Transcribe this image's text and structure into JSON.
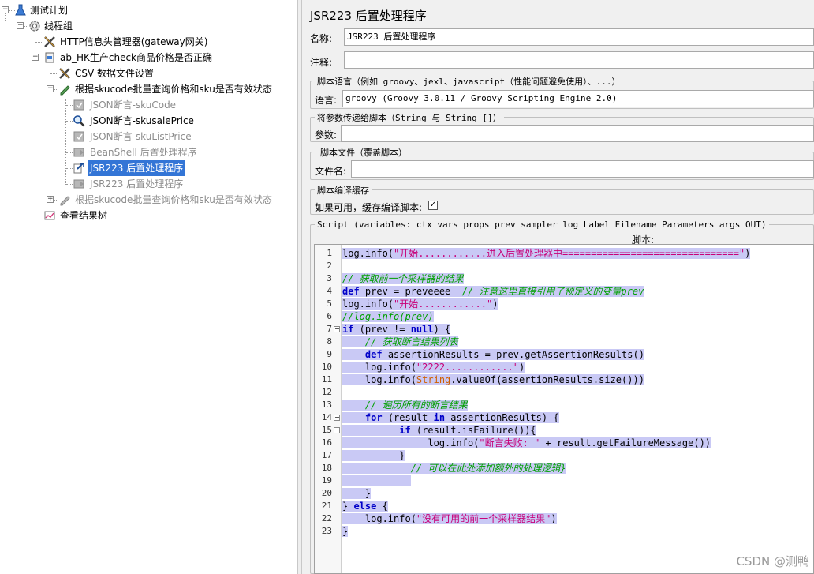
{
  "tree": {
    "nodes": [
      {
        "label": "测试计划",
        "icon": "test-plan-icon",
        "expander": "−"
      },
      {
        "label": "线程组",
        "icon": "thread-group-gear-icon",
        "expander": "−"
      },
      {
        "label": "HTTP信息头管理器(gateway网关)",
        "icon": "config-tools-icon"
      },
      {
        "label": "ab_HK生产check商品价格是否正确",
        "icon": "controller-icon",
        "expander": "−"
      },
      {
        "label": "CSV 数据文件设置",
        "icon": "config-tools-icon"
      },
      {
        "label": "根据skucode批量查询价格和sku是否有效状态",
        "icon": "sampler-pen-icon",
        "expander": "−"
      },
      {
        "label": "JSON断言-skuCode",
        "icon": "assertion-icon",
        "disabled": true
      },
      {
        "label": "JSON断言-skusalePrice",
        "icon": "magnifier-icon"
      },
      {
        "label": "JSON断言-skuListPrice",
        "icon": "assertion-icon",
        "disabled": true
      },
      {
        "label": "BeanShell 后置处理程序",
        "icon": "postprocessor-icon",
        "disabled": true
      },
      {
        "label": "JSR223 后置处理程序",
        "icon": "postprocessor-arrow-icon",
        "selected": true
      },
      {
        "label": "JSR223 后置处理程序",
        "icon": "postprocessor-icon",
        "disabled": true
      },
      {
        "label": "根据skucode批量查询价格和sku是否有效状态",
        "icon": "sampler-pen-icon",
        "expander": "+",
        "disabled": true
      },
      {
        "label": "查看结果树",
        "icon": "listener-chart-icon"
      }
    ]
  },
  "panel": {
    "title": "JSR223 后置处理程序",
    "name_label": "名称:",
    "name_value": "JSR223 后置处理程序",
    "comment_label": "注释:",
    "comment_value": "",
    "lang_group": "脚本语言（例如 groovy、jexl、javascript（性能问题避免使用）、...）",
    "lang_label": "语言:",
    "lang_value": "groovy     (Groovy 3.0.11 / Groovy Scripting Engine 2.0)",
    "params_group": "将参数传递给脚本（String 与 String []）",
    "params_label": "参数:",
    "params_value": "",
    "file_group": "脚本文件（覆盖脚本）",
    "file_label": "文件名:",
    "file_value": "",
    "cache_group": "脚本编译缓存",
    "cache_label": "如果可用，缓存编译脚本:",
    "cache_checked": "✓",
    "script_group": "Script (variables: ctx vars props prev sampler log Label Filename Parameters args OUT)",
    "script_label": "脚本:"
  },
  "code": {
    "line_numbers": [
      "1",
      "2",
      "3",
      "4",
      "5",
      "6",
      "7",
      "8",
      "9",
      "10",
      "11",
      "12",
      "13",
      "14",
      "15",
      "16",
      "17",
      "18",
      "19",
      "20",
      "21",
      "22",
      "23"
    ],
    "fold_markers": [
      {
        "line": 7,
        "glyph": "−"
      },
      {
        "line": 14,
        "glyph": "−"
      },
      {
        "line": 15,
        "glyph": "−"
      }
    ],
    "lines": [
      [
        {
          "t": "log.info("
        },
        {
          "t": "\"开始............进入后置处理器中===============================\"",
          "c": "str"
        },
        {
          "t": ")"
        }
      ],
      [],
      [
        {
          "t": "// 获取前一个采样器的结果",
          "c": "cm"
        }
      ],
      [
        {
          "t": "def",
          "c": "kw"
        },
        {
          "t": " prev = preveeee  "
        },
        {
          "t": "// 注意这里直接引用了预定义的变量prev",
          "c": "cm"
        }
      ],
      [
        {
          "t": "log.info("
        },
        {
          "t": "\"开始............\"",
          "c": "str"
        },
        {
          "t": ")"
        }
      ],
      [
        {
          "t": "//log.info(prev)",
          "c": "cm"
        }
      ],
      [
        {
          "t": "if",
          "c": "kw"
        },
        {
          "t": " (prev != "
        },
        {
          "t": "null",
          "c": "kw"
        },
        {
          "t": ") {"
        }
      ],
      [
        {
          "t": "    "
        },
        {
          "t": "// 获取断言结果列表",
          "c": "cm"
        }
      ],
      [
        {
          "t": "    "
        },
        {
          "t": "def",
          "c": "kw"
        },
        {
          "t": " assertionResults = prev.getAssertionResults()"
        }
      ],
      [
        {
          "t": "    log.info("
        },
        {
          "t": "\"2222............\"",
          "c": "str"
        },
        {
          "t": ")"
        }
      ],
      [
        {
          "t": "    log.info("
        },
        {
          "t": "String",
          "c": "tp"
        },
        {
          "t": ".valueOf(assertionResults.size()))"
        }
      ],
      [],
      [
        {
          "t": "    "
        },
        {
          "t": "// 遍历所有的断言结果",
          "c": "cm"
        }
      ],
      [
        {
          "t": "    "
        },
        {
          "t": "for",
          "c": "kw"
        },
        {
          "t": " (result "
        },
        {
          "t": "in",
          "c": "kw"
        },
        {
          "t": " assertionResults) {"
        }
      ],
      [
        {
          "t": "          "
        },
        {
          "t": "if",
          "c": "kw"
        },
        {
          "t": " (result.isFailure()){"
        }
      ],
      [
        {
          "t": "               log.info("
        },
        {
          "t": "\"断言失败: \"",
          "c": "str"
        },
        {
          "t": " + result.getFailureMessage())"
        }
      ],
      [
        {
          "t": "          }"
        }
      ],
      [
        {
          "t": "            "
        },
        {
          "t": "// 可以在此处添加额外的处理逻辑}",
          "c": "cm"
        }
      ],
      [
        {
          "t": "            "
        }
      ],
      [
        {
          "t": "    }"
        }
      ],
      [
        {
          "t": "} "
        },
        {
          "t": "else",
          "c": "kw"
        },
        {
          "t": " {"
        }
      ],
      [
        {
          "t": "    log.info("
        },
        {
          "t": "\"没有可用的前一个采样器结果\"",
          "c": "str"
        },
        {
          "t": ")"
        }
      ],
      [
        {
          "t": "}"
        }
      ]
    ]
  },
  "watermark": "CSDN @测鸭"
}
